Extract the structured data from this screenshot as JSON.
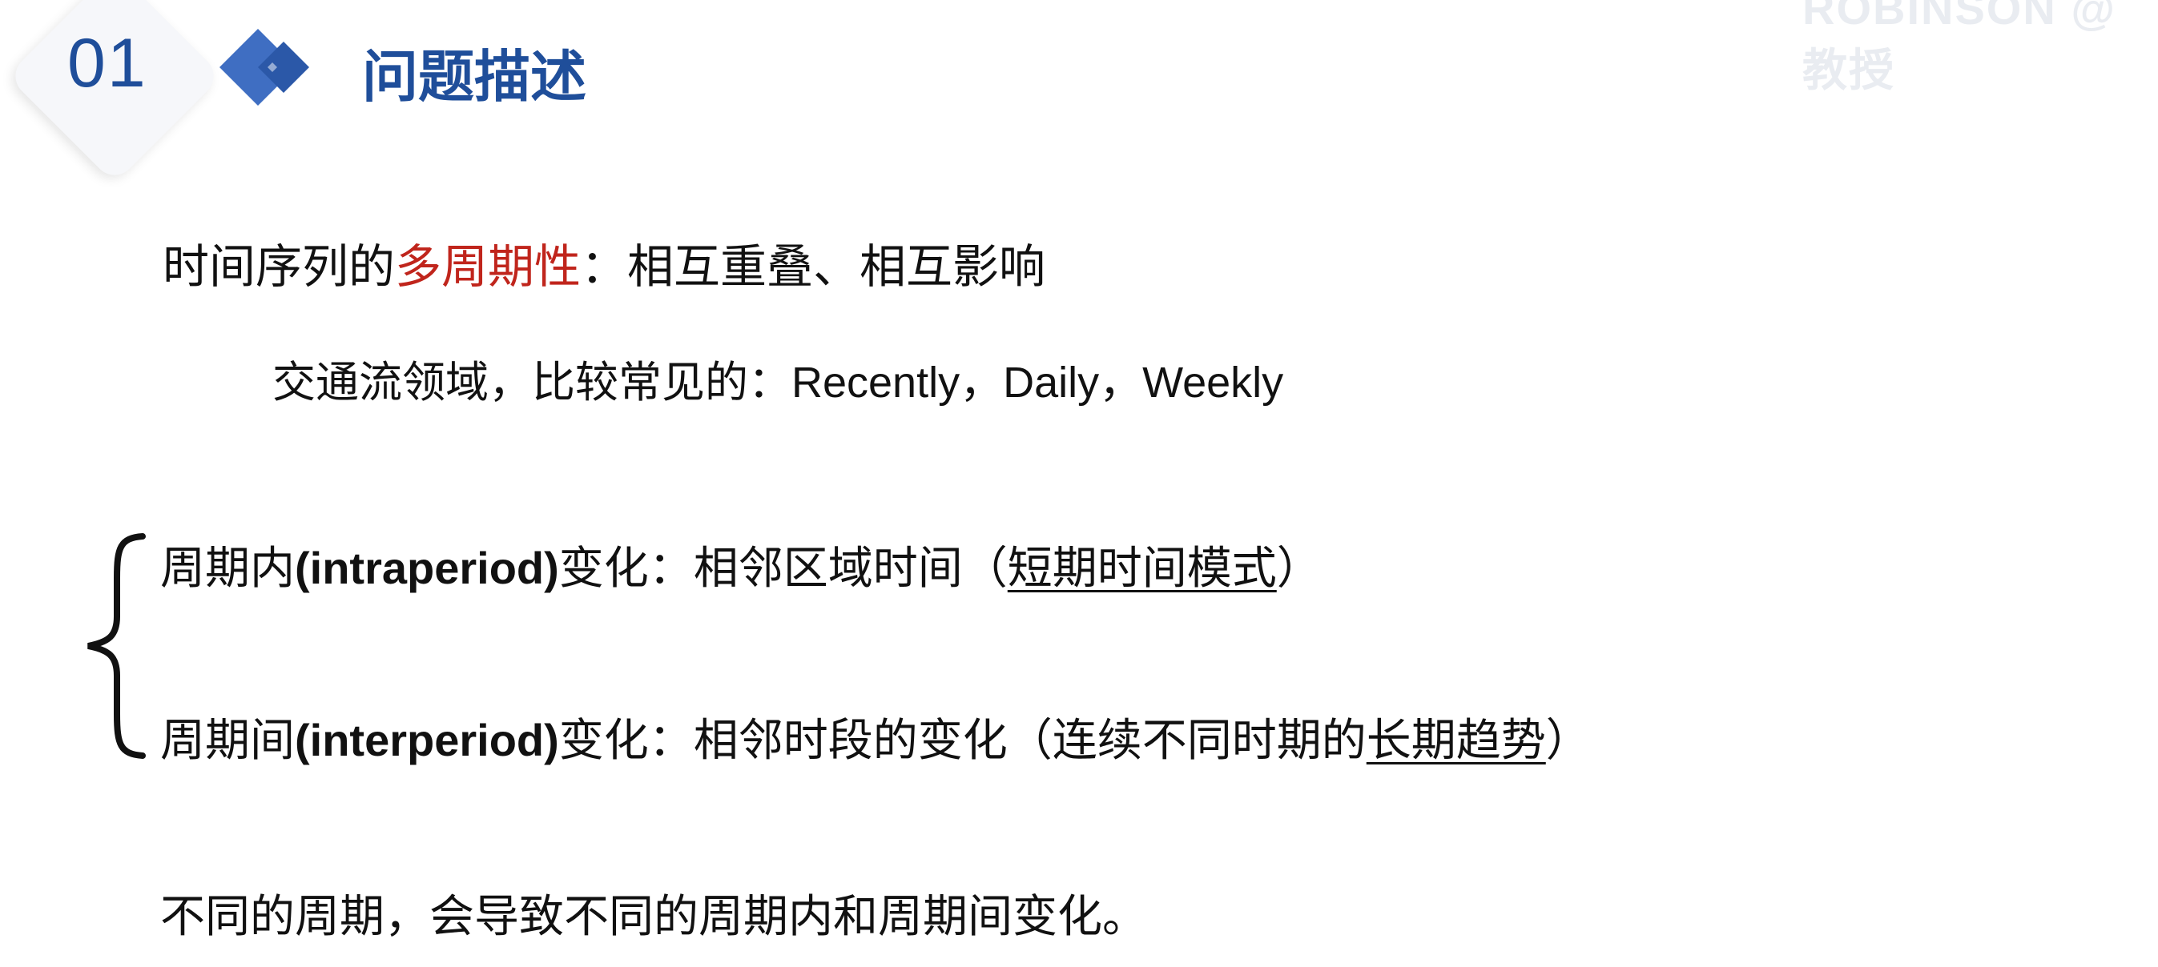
{
  "header": {
    "number": "01",
    "title": "问题描述",
    "watermark": "ROBINSON  @教授"
  },
  "content": {
    "line1": {
      "text_a": "时间序列的",
      "text_b": "多周期性",
      "text_c": "：相互重叠、相互影响"
    },
    "line2": {
      "text_a": "交通流领域，比较常见的：",
      "text_b": "Recently，Daily，Weekly"
    },
    "line3": {
      "text_a": "周期内",
      "text_b": "(intraperiod)",
      "text_c": "变化：相邻区域时间（",
      "text_d": "短期时间模式",
      "text_e": "）"
    },
    "line4": {
      "text_a": "周期间",
      "text_b": "(interperiod)",
      "text_c": "变化：相邻时段的变化（连续不同时期的",
      "text_d": "长期趋势",
      "text_e": "）"
    },
    "line5": {
      "text": "不同的周期，会导致不同的周期内和周期间变化。"
    }
  },
  "icons": {
    "brace": "curly-brace-icon",
    "section": "double-diamond-icon"
  },
  "colors": {
    "accent_blue": "#1f4e9a",
    "highlight_red": "#c0251c",
    "text": "#111111"
  }
}
